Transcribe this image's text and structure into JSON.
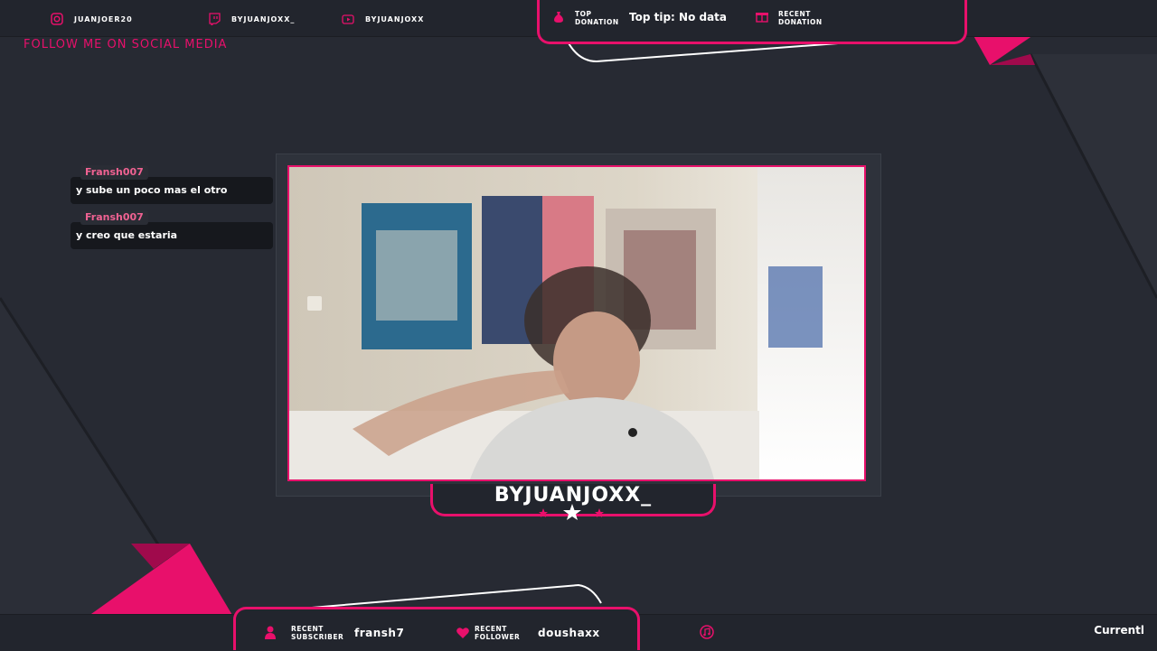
{
  "colors": {
    "accent": "#e8106b",
    "panel": "#22252d",
    "background": "#272a33"
  },
  "social": {
    "title": "FOLLOW ME ON SOCIAL MEDIA",
    "items": [
      {
        "icon": "instagram-icon",
        "label": "JUANJOER20"
      },
      {
        "icon": "twitch-icon",
        "label": "BYJUANJOXX_"
      },
      {
        "icon": "youtube-icon",
        "label": "BYJUANJOXX"
      }
    ]
  },
  "donations": {
    "top_label_1": "TOP",
    "top_label_2": "DONATION",
    "top_value": "Top tip: No data",
    "recent_label_1": "RECENT",
    "recent_label_2": "DONATION"
  },
  "chat": [
    {
      "user": "Fransh007",
      "message": "y sube un poco mas el otro"
    },
    {
      "user": "Fransh007",
      "message": "y creo que estaria"
    }
  ],
  "streamer": {
    "name": "BYJUANJOXX_"
  },
  "bottom": {
    "subscriber_label_1": "RECENT",
    "subscriber_label_2": "SUBSCRIBER",
    "subscriber_value": "fransh7",
    "follower_label_1": "RECENT",
    "follower_label_2": "FOLLOWER",
    "follower_value": "doushaxx",
    "current_text": "Currentl"
  }
}
